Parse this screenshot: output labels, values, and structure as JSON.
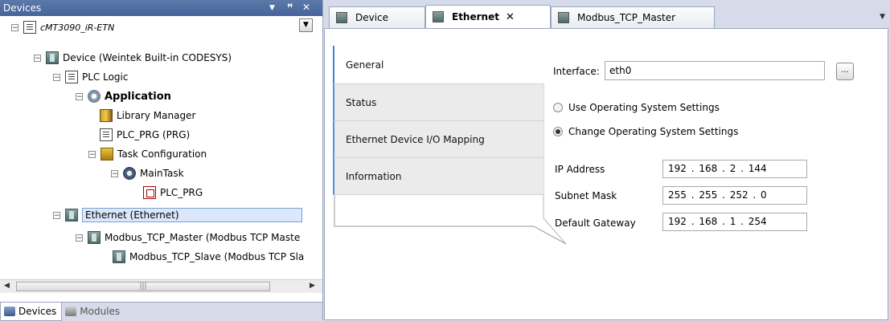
{
  "devices_panel": {
    "title": "Devices",
    "tree": [
      {
        "label": "cMT3090_iR-ETN",
        "icon": "project-icon"
      },
      {
        "label": "Device (Weintek Built-in CODESYS)",
        "icon": "device-icon"
      },
      {
        "label": "PLC Logic",
        "icon": "plc-logic-icon"
      },
      {
        "label": "Application",
        "icon": "application-icon"
      },
      {
        "label": "Library Manager",
        "icon": "library-manager-icon"
      },
      {
        "label": "PLC_PRG (PRG)",
        "icon": "program-icon"
      },
      {
        "label": "Task Configuration",
        "icon": "task-configuration-icon"
      },
      {
        "label": "MainTask",
        "icon": "task-icon"
      },
      {
        "label": "PLC_PRG",
        "icon": "program-call-icon"
      },
      {
        "label": "Ethernet (Ethernet)",
        "icon": "ethernet-icon"
      },
      {
        "label": "Modbus_TCP_Master (Modbus TCP Maste",
        "icon": "modbus-master-icon"
      },
      {
        "label": "Modbus_TCP_Slave (Modbus TCP Sla",
        "icon": "modbus-slave-icon"
      }
    ],
    "bottom_tabs": [
      "Devices",
      "Modules"
    ]
  },
  "editor_tabs": [
    {
      "label": "Device",
      "active": false
    },
    {
      "label": "Ethernet",
      "active": true
    },
    {
      "label": "Modbus_TCP_Master",
      "active": false
    }
  ],
  "side_tabs": [
    "General",
    "Status",
    "Ethernet Device I/O Mapping",
    "Information"
  ],
  "general": {
    "interface_label": "Interface:",
    "interface_value": "eth0",
    "browse_label": "...",
    "radio_use_os": "Use Operating System Settings",
    "radio_change_os": "Change Operating System Settings",
    "selected_radio": "Change Operating System Settings",
    "ip_label": "IP Address",
    "ip_value": "192 . 168 .  2  . 144",
    "subnet_label": "Subnet Mask",
    "subnet_value": "255 . 255 . 252 .  0",
    "gateway_label": "Default Gateway",
    "gateway_value": "192 . 168 .  1  . 254"
  },
  "colors": {
    "accent": "#3f7fdc",
    "selection": "#dbe7fb",
    "frame": "#d6dbe9"
  }
}
